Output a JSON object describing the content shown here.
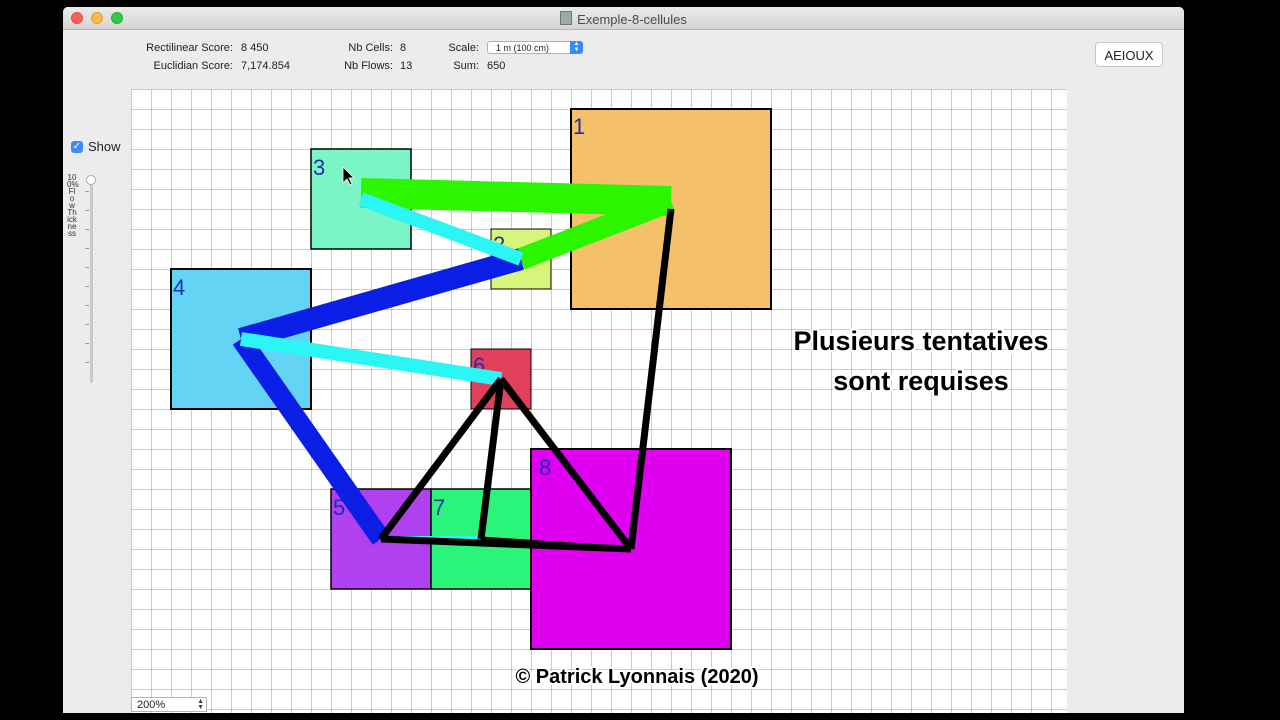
{
  "window": {
    "title": "Exemple-8-cellules"
  },
  "stats": {
    "rectilinear_label": "Rectilinear Score:",
    "rectilinear_value": "8 450",
    "euclidian_label": "Euclidian Score:",
    "euclidian_value": "7,174.854",
    "nb_cells_label": "Nb Cells:",
    "nb_cells_value": "8",
    "nb_flows_label": "Nb Flows:",
    "nb_flows_value": "13",
    "scale_label": "Scale:",
    "scale_value": "1 m (100 cm)",
    "sum_label": "Sum:",
    "sum_value": "650"
  },
  "buttons": {
    "aeioux": "AEIOUX"
  },
  "sidebar": {
    "show_label": "Show",
    "show_checked": true,
    "slider_label": "100% Flow Thickness",
    "flow_thickness_fraction": 1.0
  },
  "zoom": {
    "value": "200%"
  },
  "canvas": {
    "cells": [
      {
        "id": "1",
        "label": "1",
        "color": "#f5c06a"
      },
      {
        "id": "2",
        "label": "2",
        "color": "#d6f57a"
      },
      {
        "id": "3",
        "label": "3",
        "color": "#7cf5c6"
      },
      {
        "id": "4",
        "label": "4",
        "color": "#64d4f5"
      },
      {
        "id": "5",
        "label": "5",
        "color": "#b040f0"
      },
      {
        "id": "6",
        "label": "6",
        "color": "#e0405a"
      },
      {
        "id": "7",
        "label": "7",
        "color": "#2af57a"
      },
      {
        "id": "8",
        "label": "8",
        "color": "#e000f0"
      }
    ],
    "flow_colors": {
      "green": "#2cf500",
      "blue": "#0a1ee6",
      "cyan": "#2cf5f5",
      "black": "#000000"
    },
    "overlay_line1": "Plusieurs tentatives",
    "overlay_line2": "sont requises",
    "copyright": "© Patrick Lyonnais (2020)"
  }
}
